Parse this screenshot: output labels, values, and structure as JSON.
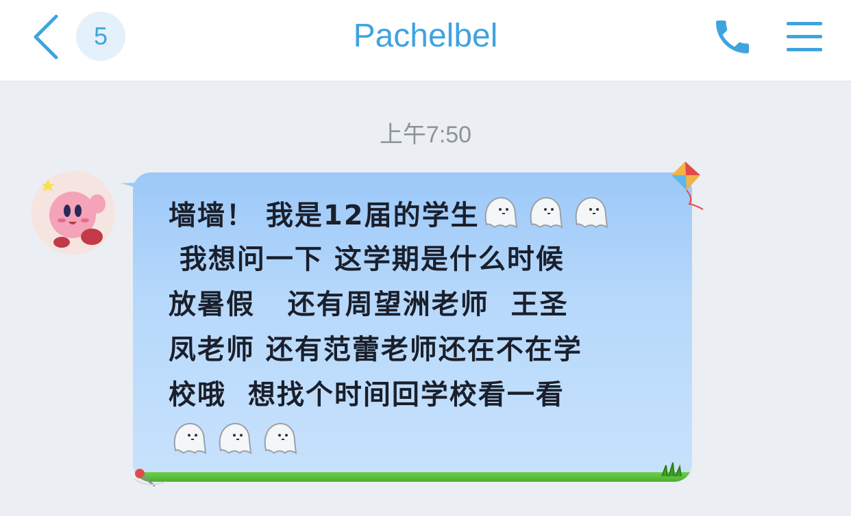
{
  "header": {
    "unread_count": "5",
    "title": "Pachelbel",
    "back_icon": "chevron-left-icon",
    "call_icon": "phone-icon",
    "menu_icon": "menu-icon",
    "accent_color": "#3fa3e0"
  },
  "chat": {
    "timestamp": "上午7:50",
    "messages": [
      {
        "sender_avatar": "kirby-avatar",
        "lines": [
          "墙墙！ 我是12届的学生",
          " 我想问一下 这学期是什么时候",
          "放暑假   还有周望洲老师  王圣",
          "凤老师 还有范蕾老师还在不在学",
          "校哦  想找个时间回学校看一看",
          ""
        ],
        "emoji": "ghost-emoji",
        "bubble_color": "#b6d8fb"
      }
    ]
  }
}
